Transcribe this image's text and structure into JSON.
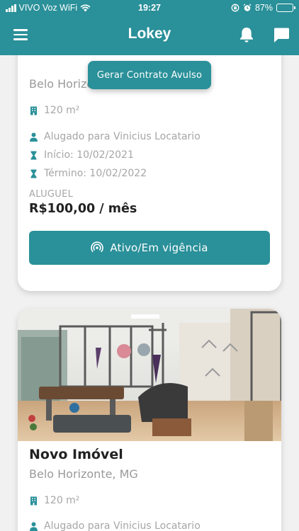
{
  "status_bar": {
    "carrier": "VIVO Voz WiFi",
    "time": "19:27",
    "battery_percent": "87%",
    "battery_level": 0.87
  },
  "app_bar": {
    "title": "Lokey",
    "menu_icon": "menu-icon",
    "notifications_icon": "bell-icon",
    "messages_icon": "chat-icon"
  },
  "floating_action": {
    "label": "Gerar Contrato Avulso"
  },
  "properties": [
    {
      "title": "",
      "city": "Belo Horizonte, MG",
      "area": "120 m²",
      "tenant": "Alugado para Vinicius Locatario",
      "start": "Início: 10/02/2021",
      "end": "Término: 10/02/2022",
      "rent_label": "ALUGUEL",
      "rent_value": "R$100,00 / mês",
      "status_label": "Ativo/Em vigência"
    },
    {
      "title": "Novo Imóvel",
      "city": "Belo Horizonte, MG",
      "area": "120 m²",
      "tenant": "Alugado para Vinicius Locatario"
    }
  ],
  "colors": {
    "primary": "#2a9099",
    "background": "#f1f1f1",
    "text_dark": "#222222",
    "text_muted": "#a6a6a6"
  }
}
